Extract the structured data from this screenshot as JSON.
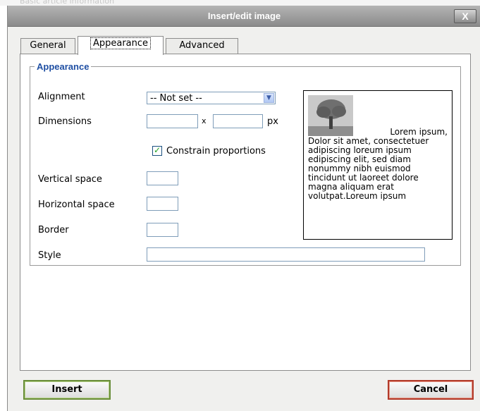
{
  "background": {
    "ghost_text": "Basic article information"
  },
  "dialog": {
    "title": "Insert/edit image",
    "close_label": "X"
  },
  "tabs": [
    {
      "label": "General",
      "active": false
    },
    {
      "label": "Appearance",
      "active": true
    },
    {
      "label": "Advanced",
      "active": false
    }
  ],
  "appearance": {
    "legend": "Appearance",
    "alignment": {
      "label": "Alignment",
      "value": "-- Not set --"
    },
    "dimensions": {
      "label": "Dimensions",
      "width": "",
      "height": "",
      "separator": "x",
      "unit": "px"
    },
    "constrain": {
      "label": "Constrain proportions",
      "checked": true
    },
    "vertical_space": {
      "label": "Vertical space",
      "value": ""
    },
    "horizontal_space": {
      "label": "Horizontal space",
      "value": ""
    },
    "border": {
      "label": "Border",
      "value": ""
    },
    "style": {
      "label": "Style",
      "value": ""
    }
  },
  "preview": {
    "first_line": "Lorem ipsum,",
    "body": "Dolor sit amet, consectetuer adipiscing loreum ipsum edipiscing elit, sed diam nonummy nibh euismod tincidunt ut laoreet dolore magna aliquam erat volutpat.Loreum ipsum"
  },
  "buttons": {
    "insert": "Insert",
    "cancel": "Cancel"
  },
  "colors": {
    "legend": "#1f4fa3",
    "insert_border": "#6a8e3a",
    "cancel_border": "#b23a2a",
    "check": "#21a121"
  }
}
